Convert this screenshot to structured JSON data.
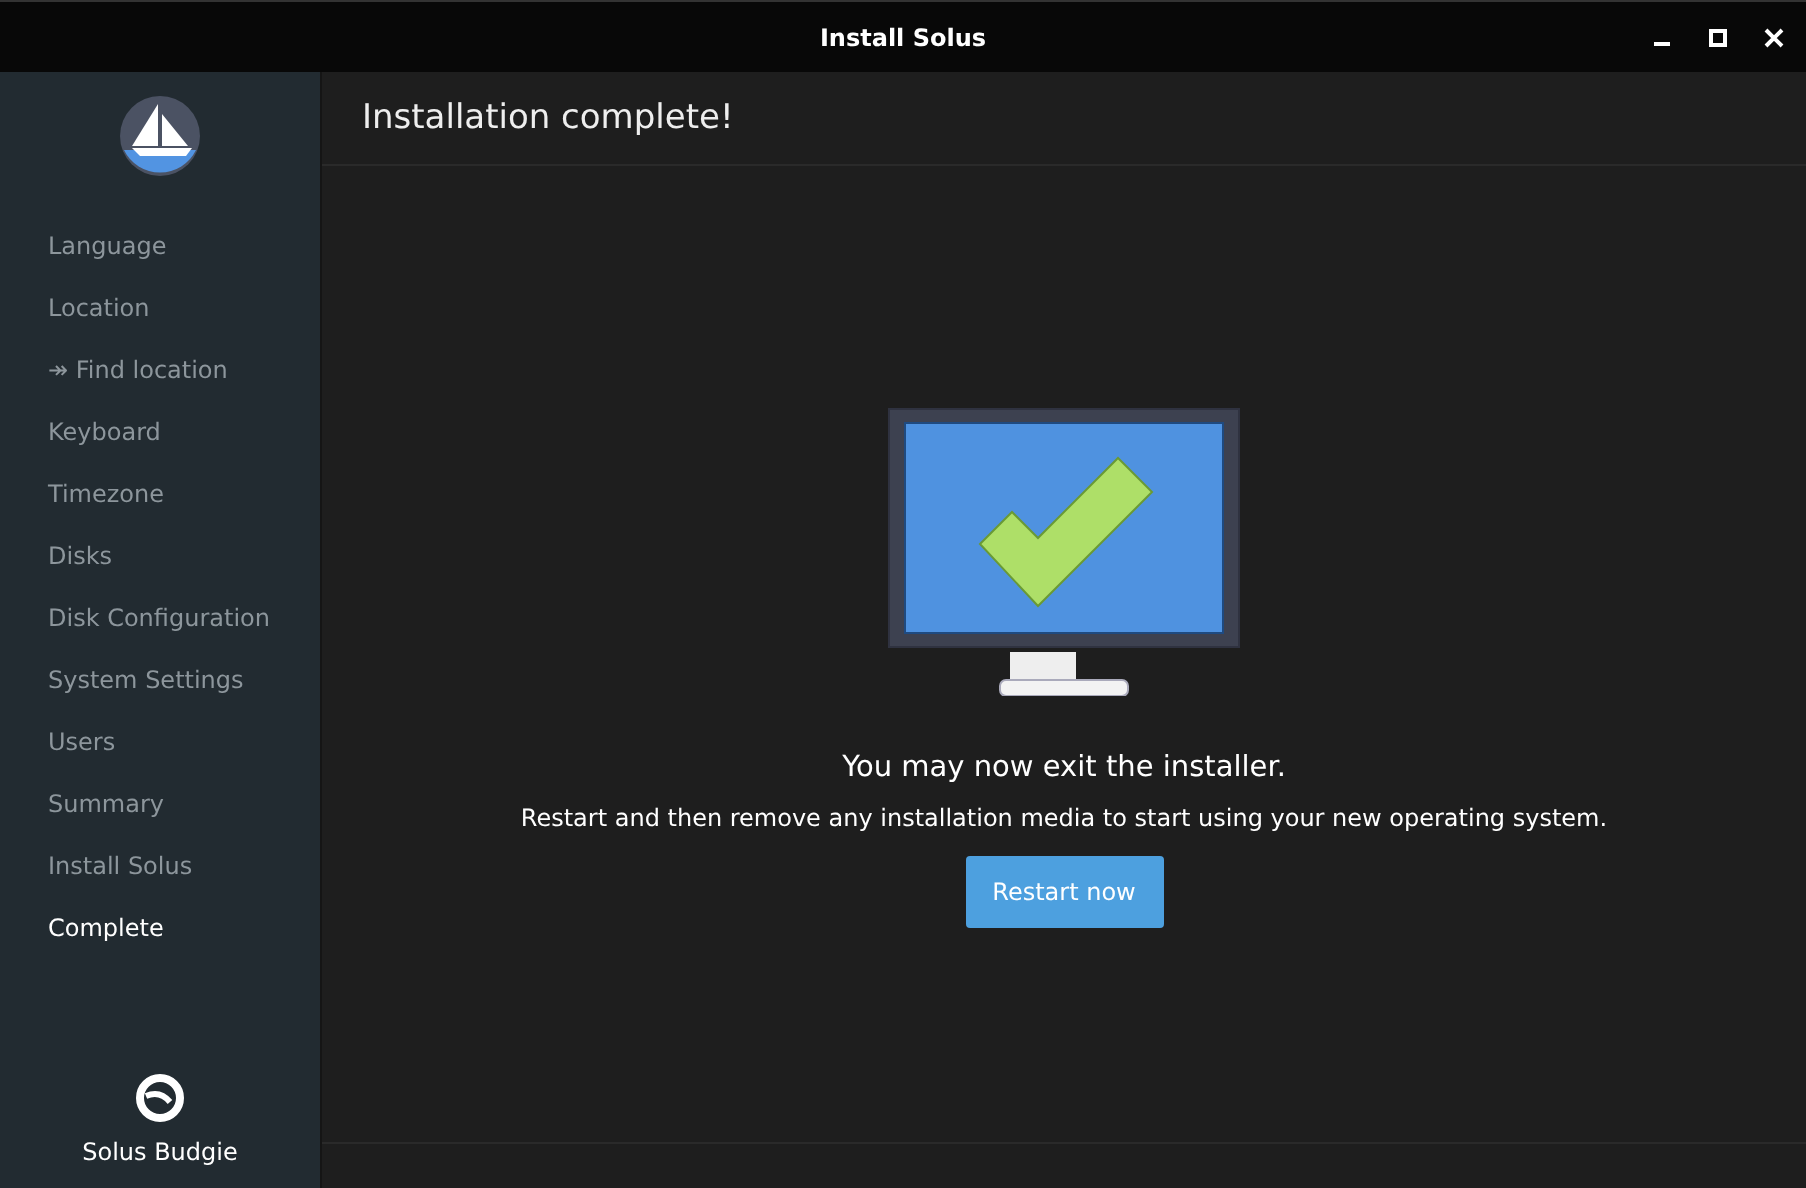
{
  "window": {
    "title": "Install Solus"
  },
  "sidebar": {
    "items": [
      {
        "label": "Language",
        "selected": false
      },
      {
        "label": "Location",
        "selected": false
      },
      {
        "label": "↠ Find location",
        "selected": false
      },
      {
        "label": "Keyboard",
        "selected": false
      },
      {
        "label": "Timezone",
        "selected": false
      },
      {
        "label": "Disks",
        "selected": false
      },
      {
        "label": "Disk Configuration",
        "selected": false
      },
      {
        "label": "System Settings",
        "selected": false
      },
      {
        "label": "Users",
        "selected": false
      },
      {
        "label": "Summary",
        "selected": false
      },
      {
        "label": "Install Solus",
        "selected": false
      },
      {
        "label": "Complete",
        "selected": true
      }
    ],
    "edition": "Solus Budgie"
  },
  "page": {
    "title": "Installation complete!",
    "heading": "You may now exit the installer.",
    "message": "Restart and then remove any installation media to start using your new operating system.",
    "button": "Restart now"
  }
}
